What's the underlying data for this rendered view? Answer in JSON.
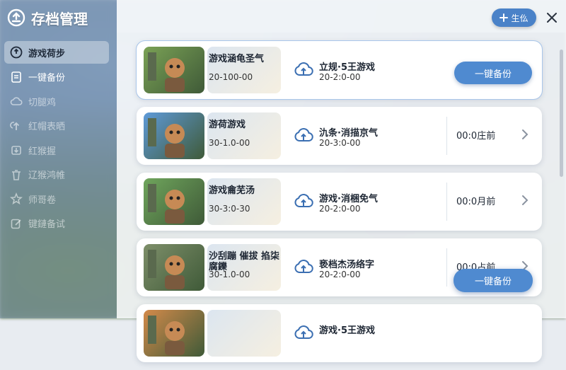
{
  "app": {
    "title": "存档管理"
  },
  "sidebar": {
    "items": [
      {
        "label": "游戏荷步",
        "icon": "cloud-sync-icon",
        "active": true
      },
      {
        "label": "一键备份",
        "icon": "document-icon",
        "active": false
      },
      {
        "label": "切腿鸡",
        "icon": "cloud-icon",
        "active": false
      },
      {
        "label": "红帽表晒",
        "icon": "upload-icon",
        "active": false
      },
      {
        "label": "红猴握",
        "icon": "download-icon",
        "active": false
      },
      {
        "label": "辽猴鸿帷",
        "icon": "trash-icon",
        "active": false
      },
      {
        "label": "师哥卷",
        "icon": "star-icon",
        "active": false
      },
      {
        "label": "键鏈备试",
        "icon": "edit-icon",
        "active": false
      }
    ]
  },
  "header": {
    "add_label": "生仫",
    "add_icon": "plus-icon",
    "close_icon": "close-icon"
  },
  "cards": [
    {
      "game_name": "游戏涵龟圣气",
      "game_date": "20-100-00",
      "save_name": "立规·5王游戏",
      "save_date": "20-2:0-00",
      "action": "button",
      "action_label": "一键备份",
      "thumb_color": "#7aa155"
    },
    {
      "game_name": "游荷游戏",
      "game_date": "30-1.0-00",
      "save_name": "氿条·消描京气",
      "save_date": "20-3:0-00",
      "action": "time",
      "action_label": "00:0庄前",
      "thumb_color": "#5e9ad8"
    },
    {
      "game_name": "游戏龠芜汤",
      "game_date": "30-3:0-30",
      "save_name": "游戏·消梱免气",
      "save_date": "20-2:0-00",
      "action": "time",
      "action_label": "00:0月前",
      "thumb_color": "#6fa55c"
    },
    {
      "game_name": "沙刮蹦 催拔 掐柒腐鑠",
      "game_date": "30-1.0-00",
      "save_name": "亵档杰汤络字",
      "save_date": "20-2:0-00",
      "action": "time",
      "action_label": "00:0占前",
      "thumb_color": "#7e8f6a"
    },
    {
      "game_name": "",
      "game_date": "",
      "save_name": "游戏·5王游戏",
      "save_date": "",
      "action": "none",
      "action_label": "",
      "thumb_color": "#d38a4a"
    }
  ],
  "floating_button": {
    "label": "一键备份"
  },
  "colors": {
    "accent": "#4f8ad0",
    "card_bg": "#ffffff"
  }
}
